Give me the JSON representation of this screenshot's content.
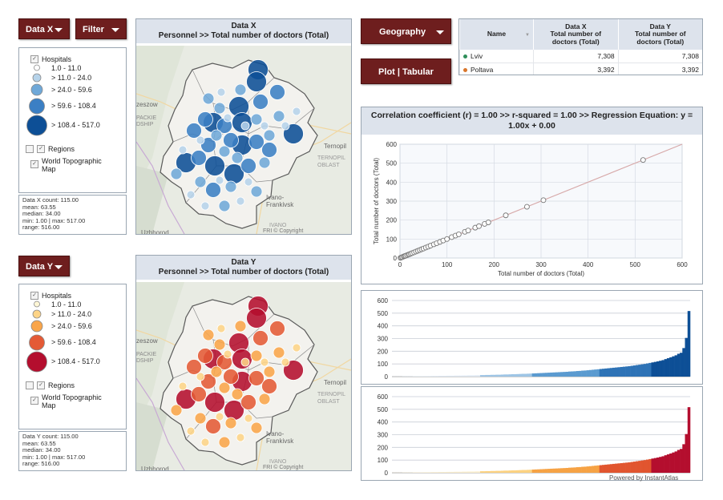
{
  "buttons": {
    "data_x": "Data X",
    "filter": "Filter",
    "data_y": "Data Y",
    "geography": "Geography",
    "plot_tabular": "Plot | Tabular"
  },
  "legend_x": {
    "hospitals": "Hospitals",
    "classes": [
      "1.0 - 11.0",
      "> 11.0 - 24.0",
      "> 24.0 - 59.6",
      "> 59.6 - 108.4",
      "> 108.4 - 517.0"
    ],
    "colors": [
      "#ffffff",
      "#b6d3ea",
      "#6fa8d8",
      "#3b7fc4",
      "#0d4f96"
    ],
    "regions": "Regions",
    "topo": "World Topographic Map"
  },
  "legend_y": {
    "hospitals": "Hospitals",
    "classes": [
      "1.0 - 11.0",
      "> 11.0 - 24.0",
      "> 24.0 - 59.6",
      "> 59.6 - 108.4",
      "> 108.4 - 517.0"
    ],
    "colors": [
      "#fff7d6",
      "#fdd487",
      "#f9a54a",
      "#e45a36",
      "#b40e2e"
    ],
    "regions": "Regions",
    "topo": "World Topographic Map"
  },
  "stats_x": {
    "count": "Data X count: 115.00",
    "mean": "mean: 63.55",
    "median": "median: 34.00",
    "minmax": "min: 1.00 | max: 517.00",
    "range": "range: 516.00"
  },
  "stats_y": {
    "count": "Data Y count: 115.00",
    "mean": "mean: 63.55",
    "median": "median: 34.00",
    "minmax": "min: 1.00 | max: 517.00",
    "range": "range: 516.00"
  },
  "map_x": {
    "title": "Data X",
    "subtitle": "Personnel >>  Total number of doctors (Total)",
    "labels": {
      "rzeszow": "zeszow",
      "podkarpackie1": "PACKIE",
      "podkarpackie2": "DSHIP",
      "ternopil": "Ternopil",
      "oblast": "TERNOPIL\nOBLAST",
      "ivano": "Ivano-\nFrankivsk",
      "ivano_obl": "IVANO",
      "uzhhorod": "Uzhhorod",
      "credit": "FRI © Copyright"
    }
  },
  "map_y": {
    "title": "Data Y",
    "subtitle": "Personnel >>  Total number of doctors (Total)",
    "labels": {
      "rzeszow": "zeszow",
      "podkarpackie1": "PACKIE",
      "podkarpackie2": "DSHIP",
      "ternopil": "Ternopil",
      "oblast": "TERNOPIL\nOBLAST",
      "ivano": "Ivano-\nFrankivsk",
      "ivano_obl": "IVANO",
      "uzhhorod": "Uzhhorod",
      "credit": "FRI © Copyright"
    }
  },
  "table": {
    "headers": [
      "Name",
      "Data X\nTotal number of\ndoctors (Total)",
      "Data Y\nTotal number of\ndoctors (Total)"
    ],
    "rows": [
      {
        "name": "Lviv",
        "x": "7,308",
        "y": "7,308",
        "color": "#2f8f5a"
      },
      {
        "name": "Poltava",
        "x": "3,392",
        "y": "3,392",
        "color": "#d9762b"
      }
    ]
  },
  "correlation": {
    "title": "Correlation coefficient (r) = 1.00  >> r-squared =  1.00 >> Regression Equation: y = 1.00x  + 0.00"
  },
  "chart_data": [
    {
      "type": "scatter",
      "title": "Correlation coefficient (r) = 1.00  >> r-squared =  1.00 >> Regression Equation: y = 1.00x  + 0.00",
      "xlabel": "Total number of doctors (Total)",
      "ylabel": "Total number of doctors (Total)",
      "xlim": [
        0,
        600
      ],
      "ylim": [
        0,
        600
      ],
      "xticks": [
        0,
        100,
        200,
        300,
        400,
        500,
        600
      ],
      "yticks": [
        0,
        100,
        200,
        300,
        400,
        500,
        600
      ],
      "grid": true,
      "trendline": {
        "slope": 1.0,
        "intercept": 0.0
      },
      "points": [
        [
          1,
          1
        ],
        [
          3,
          3
        ],
        [
          5,
          5
        ],
        [
          8,
          8
        ],
        [
          10,
          10
        ],
        [
          12,
          12
        ],
        [
          15,
          15
        ],
        [
          18,
          18
        ],
        [
          20,
          20
        ],
        [
          23,
          23
        ],
        [
          26,
          26
        ],
        [
          30,
          30
        ],
        [
          34,
          34
        ],
        [
          38,
          38
        ],
        [
          42,
          42
        ],
        [
          46,
          46
        ],
        [
          50,
          50
        ],
        [
          55,
          55
        ],
        [
          60,
          60
        ],
        [
          65,
          65
        ],
        [
          72,
          72
        ],
        [
          78,
          78
        ],
        [
          85,
          85
        ],
        [
          92,
          92
        ],
        [
          100,
          100
        ],
        [
          110,
          110
        ],
        [
          118,
          118
        ],
        [
          125,
          125
        ],
        [
          138,
          138
        ],
        [
          145,
          145
        ],
        [
          160,
          160
        ],
        [
          168,
          168
        ],
        [
          180,
          180
        ],
        [
          188,
          188
        ],
        [
          225,
          225
        ],
        [
          270,
          270
        ],
        [
          305,
          305
        ],
        [
          517,
          517
        ]
      ]
    },
    {
      "type": "bar",
      "series_name": "Data X",
      "ylim": [
        0,
        600
      ],
      "yticks": [
        0,
        100,
        200,
        300,
        400,
        500,
        600
      ],
      "class_breaks": [
        11,
        24,
        59.6,
        108.4
      ],
      "class_colors": [
        "#dfe9f3",
        "#9ec5e5",
        "#5b9bd0",
        "#2e73b6",
        "#0d4f96"
      ],
      "values": [
        1,
        1,
        1,
        1,
        2,
        2,
        2,
        2,
        3,
        3,
        3,
        3,
        4,
        4,
        4,
        5,
        5,
        5,
        6,
        6,
        6,
        7,
        7,
        7,
        8,
        8,
        8,
        9,
        9,
        10,
        10,
        10,
        11,
        11,
        12,
        12,
        13,
        13,
        14,
        14,
        15,
        15,
        16,
        17,
        17,
        18,
        19,
        19,
        20,
        21,
        22,
        22,
        23,
        24,
        25,
        26,
        27,
        28,
        29,
        30,
        31,
        32,
        33,
        34,
        35,
        36,
        37,
        38,
        40,
        41,
        42,
        44,
        45,
        47,
        48,
        50,
        52,
        54,
        56,
        58,
        60,
        62,
        64,
        66,
        68,
        70,
        72,
        74,
        76,
        78,
        80,
        82,
        85,
        88,
        91,
        94,
        97,
        100,
        104,
        108,
        112,
        116,
        120,
        125,
        130,
        138,
        145,
        152,
        160,
        168,
        180,
        188,
        225,
        305,
        517
      ]
    },
    {
      "type": "bar",
      "series_name": "Data Y",
      "ylim": [
        0,
        600
      ],
      "yticks": [
        0,
        100,
        200,
        300,
        400,
        500,
        600
      ],
      "class_breaks": [
        11,
        24,
        59.6,
        108.4
      ],
      "class_colors": [
        "#fbefcf",
        "#fcd281",
        "#f6a244",
        "#e1552f",
        "#b40e2e"
      ],
      "values": [
        1,
        1,
        1,
        1,
        2,
        2,
        2,
        2,
        3,
        3,
        3,
        3,
        4,
        4,
        4,
        5,
        5,
        5,
        6,
        6,
        6,
        7,
        7,
        7,
        8,
        8,
        8,
        9,
        9,
        10,
        10,
        10,
        11,
        11,
        12,
        12,
        13,
        13,
        14,
        14,
        15,
        15,
        16,
        17,
        17,
        18,
        19,
        19,
        20,
        21,
        22,
        22,
        23,
        24,
        25,
        26,
        27,
        28,
        29,
        30,
        31,
        32,
        33,
        34,
        35,
        36,
        37,
        38,
        40,
        41,
        42,
        44,
        45,
        47,
        48,
        50,
        52,
        54,
        56,
        58,
        60,
        62,
        64,
        66,
        68,
        70,
        72,
        74,
        76,
        78,
        80,
        82,
        85,
        88,
        91,
        94,
        97,
        100,
        104,
        108,
        112,
        116,
        120,
        125,
        130,
        138,
        145,
        152,
        160,
        168,
        180,
        188,
        225,
        305,
        517
      ]
    }
  ],
  "footer": {
    "powered": "Powered by InstantAtlas"
  }
}
